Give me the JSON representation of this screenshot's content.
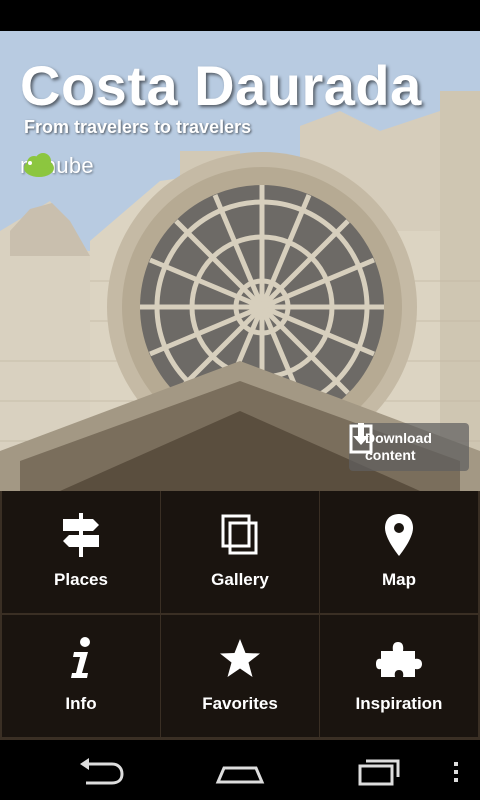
{
  "header": {
    "title": "Costa Daurada",
    "subtitle": "From travelers to travelers",
    "brand": "minube"
  },
  "download": {
    "line1": "Download",
    "line2": "content",
    "icon": "download-icon"
  },
  "menu": {
    "places": {
      "label": "Places",
      "icon": "signpost-icon"
    },
    "gallery": {
      "label": "Gallery",
      "icon": "gallery-icon"
    },
    "map": {
      "label": "Map",
      "icon": "map-pin-icon"
    },
    "info": {
      "label": "Info",
      "icon": "info-icon"
    },
    "favorites": {
      "label": "Favorites",
      "icon": "star-icon"
    },
    "inspiration": {
      "label": "Inspiration",
      "icon": "puzzle-icon"
    }
  },
  "nav": {
    "back": "back-icon",
    "home": "home-icon",
    "recents": "recent-apps-icon",
    "overflow": "overflow-menu-icon"
  },
  "colors": {
    "brand_green": "#8cc63f",
    "tile_bg": "#14100c",
    "text": "#ffffff"
  }
}
